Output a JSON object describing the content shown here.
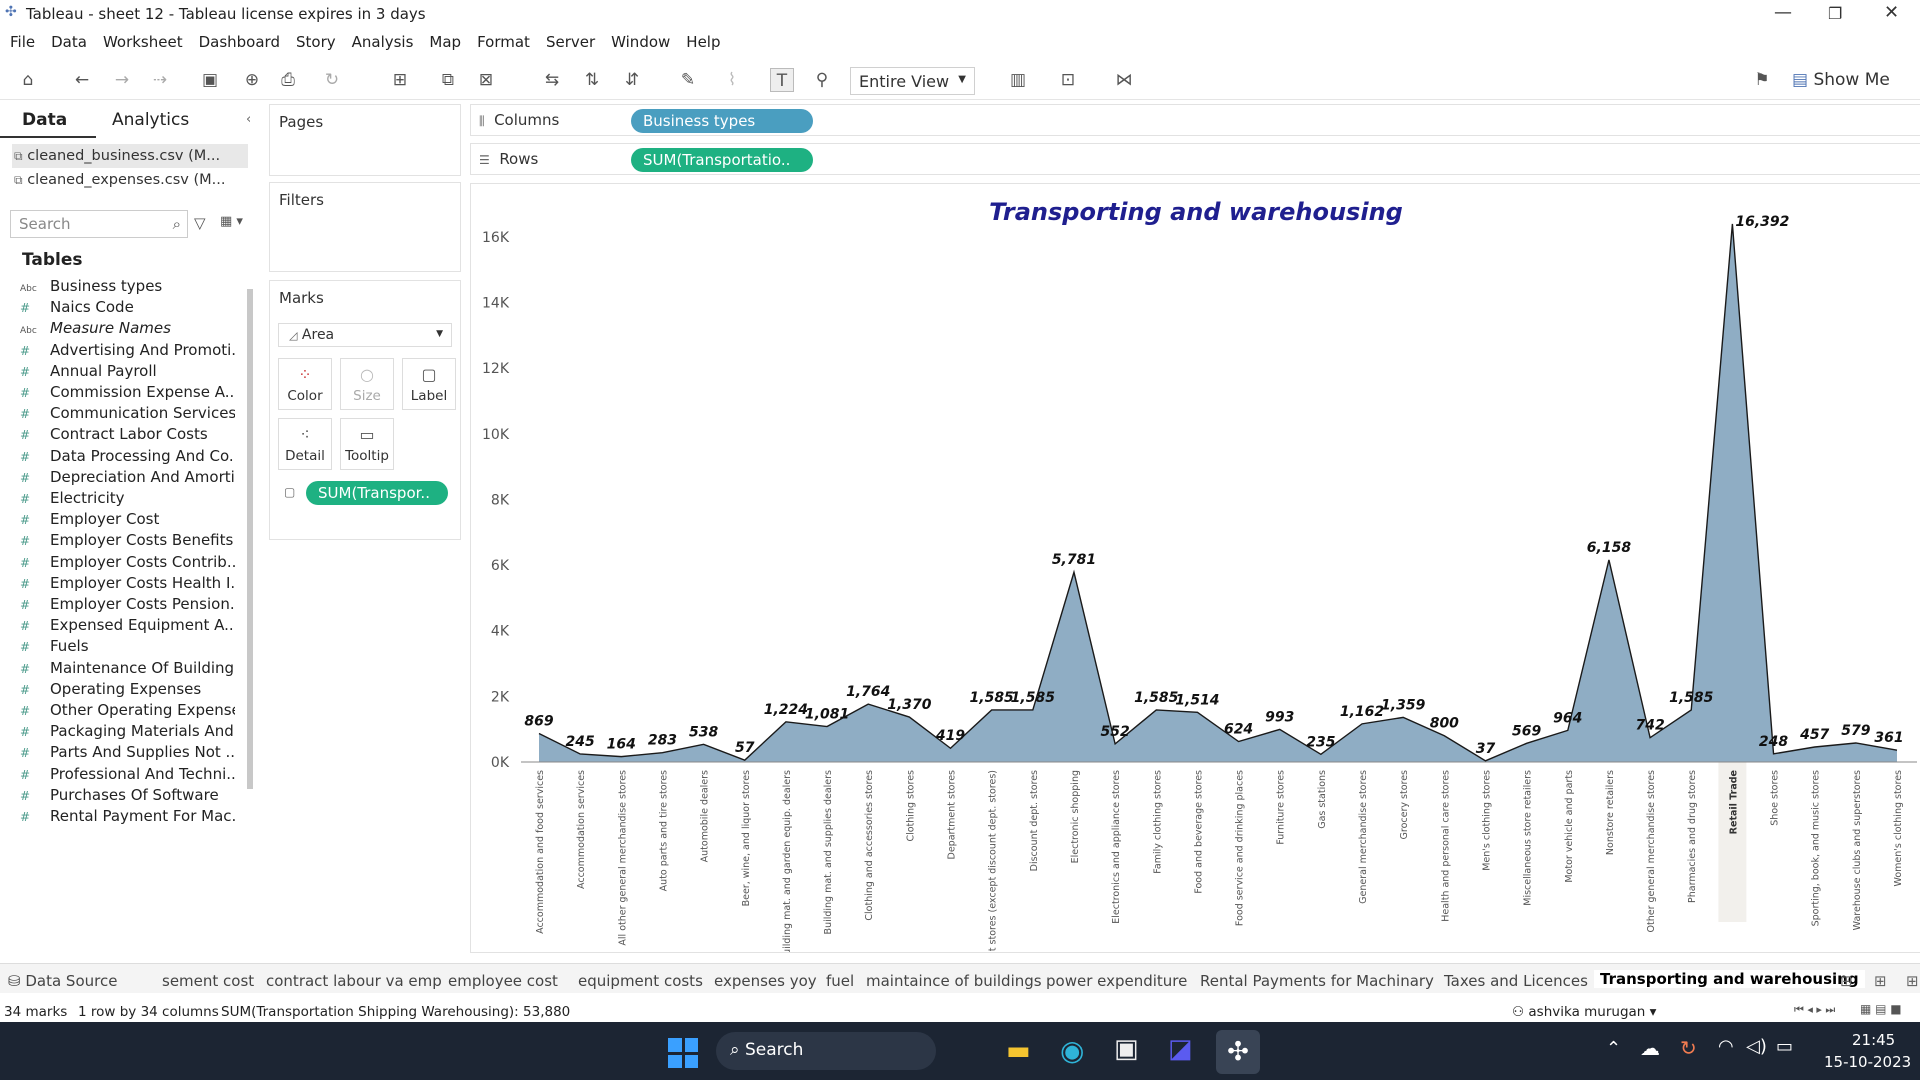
{
  "window": {
    "title": "Tableau - sheet 12 - Tableau license expires in 3 days"
  },
  "menu": [
    "File",
    "Data",
    "Worksheet",
    "Dashboard",
    "Story",
    "Analysis",
    "Map",
    "Format",
    "Server",
    "Window",
    "Help"
  ],
  "toolbar": {
    "fit_mode": "Entire View",
    "show_me": "Show Me"
  },
  "left": {
    "tabs": [
      "Data",
      "Analytics"
    ],
    "sources": [
      "cleaned_business.csv (M...",
      "cleaned_expenses.csv (M..."
    ],
    "search_placeholder": "Search",
    "tables_header": "Tables",
    "fields": [
      {
        "type": "abc",
        "name": "Business types"
      },
      {
        "type": "num",
        "name": "Naics Code"
      },
      {
        "type": "abc",
        "name": "Measure Names"
      },
      {
        "type": "num",
        "name": "Advertising And Promoti..."
      },
      {
        "type": "num",
        "name": "Annual Payroll"
      },
      {
        "type": "num",
        "name": "Commission Expense A..."
      },
      {
        "type": "num",
        "name": "Communication Services"
      },
      {
        "type": "num",
        "name": "Contract Labor Costs"
      },
      {
        "type": "num",
        "name": "Data Processing And Co..."
      },
      {
        "type": "num",
        "name": "Depreciation And Amorti..."
      },
      {
        "type": "num",
        "name": "Electricity"
      },
      {
        "type": "num",
        "name": "Employer Cost"
      },
      {
        "type": "num",
        "name": "Employer Costs Benefits"
      },
      {
        "type": "num",
        "name": "Employer Costs Contrib..."
      },
      {
        "type": "num",
        "name": "Employer Costs Health I..."
      },
      {
        "type": "num",
        "name": "Employer Costs Pension..."
      },
      {
        "type": "num",
        "name": "Expensed Equipment A..."
      },
      {
        "type": "num",
        "name": "Fuels"
      },
      {
        "type": "num",
        "name": "Maintenance Of Building..."
      },
      {
        "type": "num",
        "name": "Operating Expenses"
      },
      {
        "type": "num",
        "name": "Other Operating Expenses"
      },
      {
        "type": "num",
        "name": "Packaging Materials And..."
      },
      {
        "type": "num",
        "name": "Parts And Supplies Not ..."
      },
      {
        "type": "num",
        "name": "Professional And Techni..."
      },
      {
        "type": "num",
        "name": "Purchases Of Software"
      },
      {
        "type": "num",
        "name": "Rental Payment For Mac..."
      }
    ]
  },
  "cards": {
    "pages": "Pages",
    "filters": "Filters",
    "marks": "Marks",
    "mark_type": "Area",
    "buttons": [
      "Color",
      "Size",
      "Label",
      "Detail",
      "Tooltip"
    ],
    "mark_pill": "SUM(Transpor.."
  },
  "shelves": {
    "columns_label": "Columns",
    "columns_pill": "Business types",
    "rows_label": "Rows",
    "rows_pill": "SUM(Transportatio.."
  },
  "chart_data": {
    "type": "area",
    "title": "Transporting and warehousing",
    "xlabel": "",
    "ylabel": "",
    "ylim": [
      0,
      17000
    ],
    "yticks": [
      0,
      2000,
      4000,
      6000,
      8000,
      10000,
      12000,
      14000,
      16000
    ],
    "ytick_labels": [
      "0K",
      "2K",
      "4K",
      "6K",
      "8K",
      "10K",
      "12K",
      "14K",
      "16K"
    ],
    "categories": [
      "Accommodation and food services",
      "Accommodation services",
      "All other general merchandise stores",
      "Auto parts and tire stores",
      "Automobile dealers",
      "Beer, wine, and liquor stores",
      "Building mat. and garden equip. dealers",
      "Building mat. and supplies dealers",
      "Clothing and accessories stores",
      "Clothing stores",
      "Department stores",
      "Department stores (except discount dept. stores)",
      "Discount dept. stores",
      "Electronic shopping",
      "Electronics and appliance stores",
      "Family clothing stores",
      "Food and beverage stores",
      "Food service and drinking places",
      "Furniture stores",
      "Gas stations",
      "General merchandise stores",
      "Grocery stores",
      "Health and personal care stores",
      "Men's clothing stores",
      "Miscellaneous store retailers",
      "Motor vehicle and parts",
      "Nonstore retailers",
      "Other general merchandise stores",
      "Pharmacies and drug stores",
      "Retail Trade",
      "Shoe stores",
      "Sporting, book, and music stores",
      "Warehouse clubs and superstores",
      "Women's clothing stores"
    ],
    "values": [
      869,
      245,
      164,
      283,
      538,
      57,
      1224,
      1081,
      1764,
      1370,
      419,
      1585,
      1585,
      5781,
      552,
      1585,
      1514,
      624,
      993,
      235,
      1162,
      1359,
      800,
      37,
      569,
      964,
      6158,
      742,
      1585,
      16392,
      248,
      457,
      579,
      361
    ],
    "value_labels": [
      "869",
      "245",
      "164",
      "283",
      "538",
      "57",
      "1,224",
      "1,081",
      "1,764",
      "1,370",
      "419",
      "1,585",
      "1,585",
      "5,781",
      "552",
      "1,585",
      "1,514",
      "624",
      "993",
      "235",
      "1,162",
      "1,359",
      "800",
      "37",
      "569",
      "964",
      "6,158",
      "742",
      "1,585",
      "16,392",
      "248",
      "457",
      "579",
      "361"
    ],
    "highlighted": "Retail Trade",
    "fill_color": "#8fadc4",
    "line_color": "#1a1a1a",
    "title_color": "#1f1f8f",
    "grid": false
  },
  "sheet_tabs": [
    "Data Source",
    "sement cost",
    "contract labour va emp",
    "employee cost",
    "equipment costs",
    "expenses yoy",
    "fuel",
    "maintaince of buildings",
    "power expenditure",
    "Rental Payments for Machinary",
    "Taxes and Licences",
    "Transporting and warehousing"
  ],
  "status": {
    "marks": "34 marks",
    "dims": "1 row by 34 columns",
    "sum": "SUM(Transportation Shipping Warehousing): 53,880",
    "user": "ashvika murugan"
  },
  "taskbar": {
    "search": "Search",
    "time": "21:45",
    "date": "15-10-2023"
  }
}
